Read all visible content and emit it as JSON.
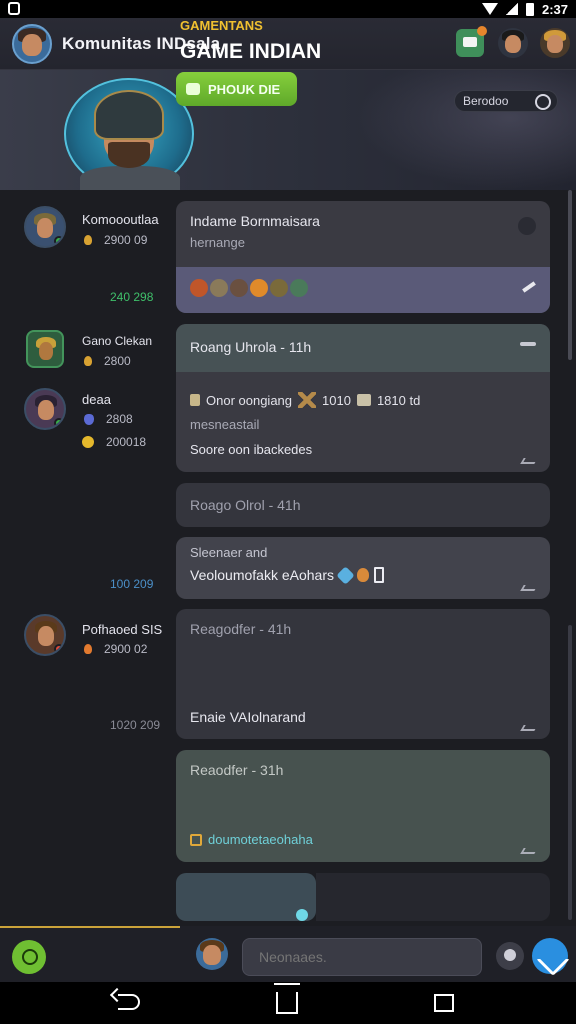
{
  "status_bar": {
    "time": "2:37"
  },
  "header": {
    "title": "Komunitas INDsala"
  },
  "banner": {
    "subtitle": "GAMENTANS",
    "title": "GAME INDIAN",
    "join_label": "PHOUK DIE",
    "tag_label": "Berodoo"
  },
  "users": [
    {
      "name": "Komoooutlaa",
      "score": "2900 09",
      "stamp": "240 298"
    },
    {
      "name": "Gano Clekan",
      "score": "2800"
    },
    {
      "name": "deaa",
      "score": "2808",
      "extra": "200018",
      "stamp": "100 209"
    },
    {
      "name": "Pofhaoed SIS",
      "score": "2900 02",
      "stamp": "1020 209"
    }
  ],
  "cards": [
    {
      "title": "Indame Bornmaisara",
      "subtitle": "hernange"
    },
    {
      "title": "Roang Uhrola - 11h",
      "line1": "Onor oongiang",
      "line1_num": "1010",
      "line1_tail": "1810 td",
      "line2": "mesneastail",
      "line3": "Soore oon ibackedes"
    },
    {
      "title": "Roago Olrol - 41h"
    },
    {
      "title": "Sleenaer and",
      "subtitle": "Veoloumofakk eAohars"
    },
    {
      "title": "Reagodfer - 41h",
      "body": "Enaie VAIolnarand"
    },
    {
      "title": "Reaodfer - 31h",
      "body": "doumotetaeohaha"
    }
  ],
  "composer": {
    "placeholder": "Neonaaes."
  },
  "colors": {
    "accent_green": "#6fbf32",
    "accent_blue": "#2a8fe0",
    "banner_gold": "#f0c030",
    "card_bg": "#3a3a42"
  }
}
